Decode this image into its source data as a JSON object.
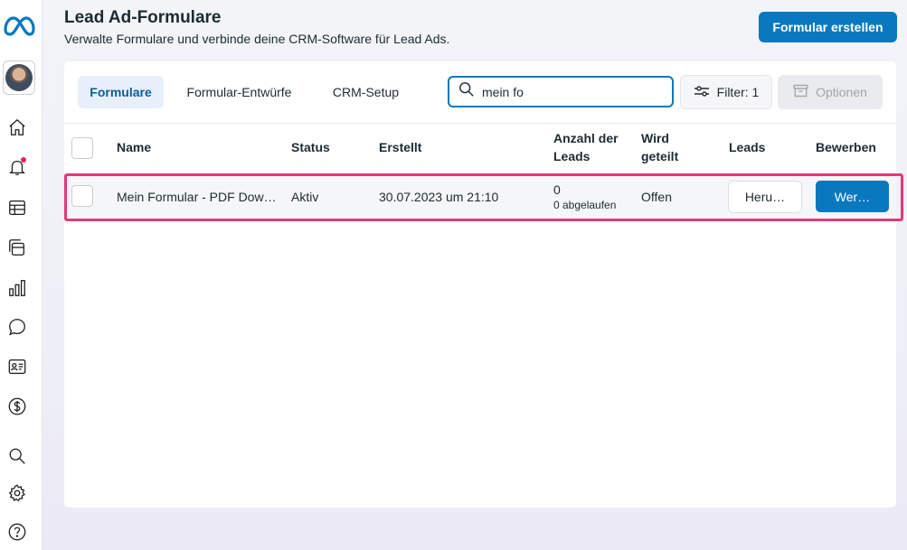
{
  "header": {
    "title": "Lead Ad-Formulare",
    "subtitle": "Verwalte Formulare und verbinde deine CRM-Software für Lead Ads.",
    "create_button": "Formular erstellen"
  },
  "sidebar": {
    "logo": "meta-logo-icon",
    "items": [
      {
        "icon": "home-icon"
      },
      {
        "icon": "bell-icon",
        "badge": true
      },
      {
        "icon": "table-icon"
      },
      {
        "icon": "pages-icon"
      },
      {
        "icon": "bar-chart-icon"
      },
      {
        "icon": "chat-bubble-icon"
      },
      {
        "icon": "contact-card-icon"
      },
      {
        "icon": "dollar-icon"
      },
      {
        "icon": "search-icon"
      },
      {
        "icon": "gear-icon"
      },
      {
        "icon": "help-icon"
      }
    ]
  },
  "tabs": [
    {
      "label": "Formulare",
      "active": true
    },
    {
      "label": "Formular-Entwürfe",
      "active": false
    },
    {
      "label": "CRM-Setup",
      "active": false
    }
  ],
  "search": {
    "value": "mein fo"
  },
  "filter_button": "Filter: 1",
  "options_button": "Optionen",
  "table": {
    "columns": {
      "name": "Name",
      "status": "Status",
      "created": "Erstellt",
      "lead_count_line1": "Anzahl der",
      "lead_count_line2": "Leads",
      "shared_line1": "Wird",
      "shared_line2": "geteilt",
      "leads": "Leads",
      "promote": "Bewerben"
    },
    "rows": [
      {
        "name": "Mein Formular - PDF Dow…",
        "status": "Aktiv",
        "created": "30.07.2023 um 21:10",
        "lead_count": "0",
        "expired": "0 abgelaufen",
        "shared": "Offen",
        "leads_button": "Heru…",
        "promote_button": "Wer…"
      }
    ]
  },
  "colors": {
    "primary": "#0a78be",
    "highlight": "#e23a78",
    "notification": "#e0245e"
  }
}
